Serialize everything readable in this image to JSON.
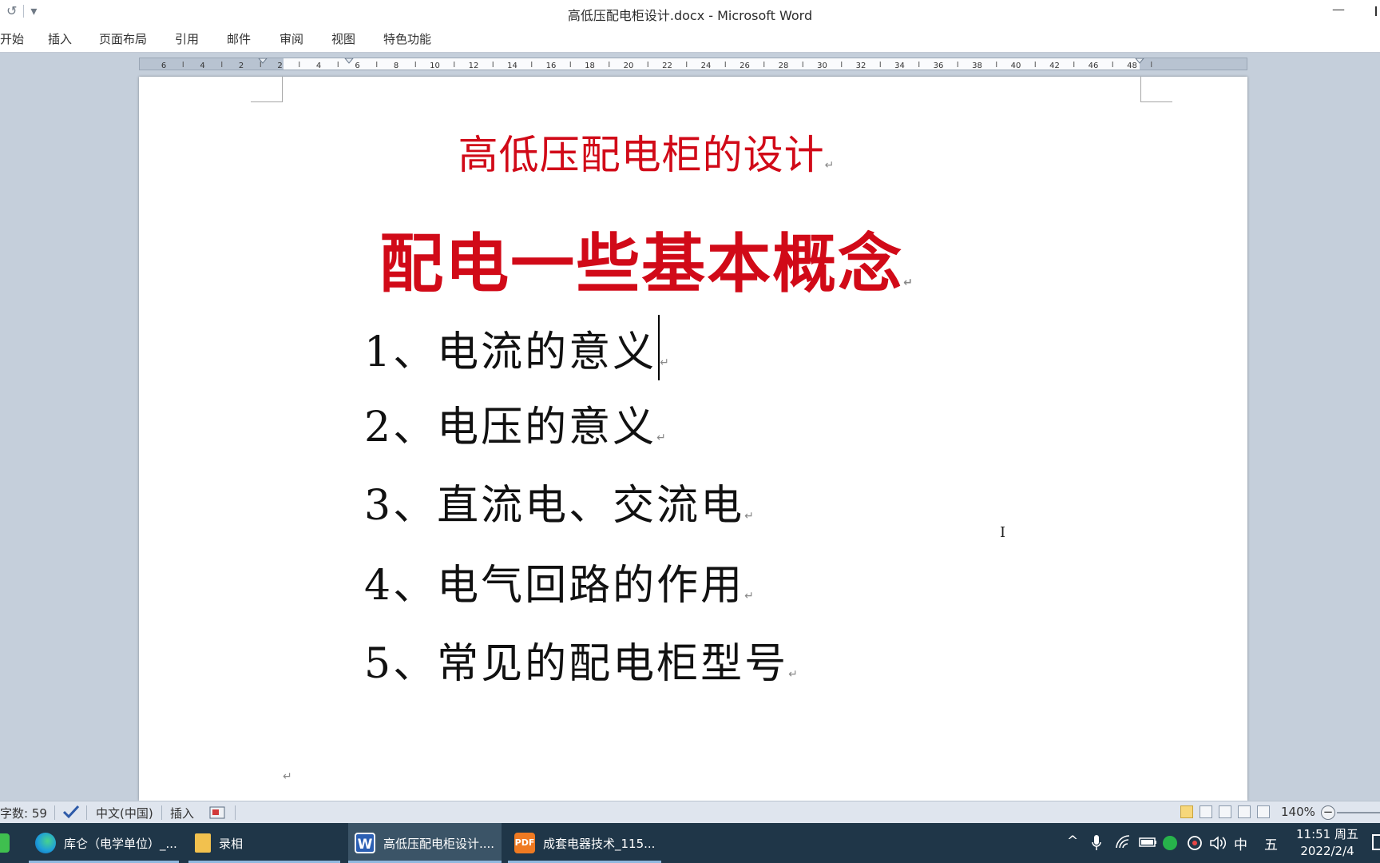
{
  "window": {
    "title": "高低压配电柜设计.docx - Microsoft Word",
    "minimize_glyph": "—"
  },
  "qat": {
    "undo_icon": "↺",
    "dropdown_icon": "▾"
  },
  "ribbon": {
    "tabs": [
      "开始",
      "插入",
      "页面布局",
      "引用",
      "邮件",
      "审阅",
      "视图",
      "特色功能"
    ]
  },
  "ruler": {
    "labels": [
      "6",
      "4",
      "2",
      "2",
      "4",
      "6",
      "8",
      "10",
      "12",
      "14",
      "16",
      "18",
      "20",
      "22",
      "24",
      "26",
      "28",
      "30",
      "32",
      "34",
      "36",
      "38",
      "40",
      "42",
      "46",
      "48"
    ]
  },
  "document": {
    "title": "高低压配电柜的设计",
    "subtitle": "配电一些基本概念",
    "items": [
      "1、电流的意义",
      "2、电压的意义",
      "3、直流电、交流电",
      "4、电气回路的作用",
      "5、常见的配电柜型号"
    ],
    "paragraph_mark": "↵",
    "ibeam_glyph": "I"
  },
  "statusbar": {
    "word_count": "字数: 59",
    "language": "中文(中国)",
    "mode": "插入",
    "zoom": "140%",
    "zoom_minus": "−"
  },
  "taskbar": {
    "apps": [
      {
        "label": "库仑（电学单位）_...",
        "icon": "edge-icon"
      },
      {
        "label": "录相",
        "icon": "folder-icon"
      },
      {
        "label": "高低压配电柜设计....",
        "icon": "word-icon"
      },
      {
        "label": "成套电器技术_115...",
        "icon": "pdf-icon"
      }
    ],
    "word_icon_letter": "W",
    "pdf_icon_letter": "PDF",
    "tray": {
      "chevron": "^",
      "ime_lang": "中",
      "ime_mode": "五"
    },
    "clock": {
      "time": "11:51 周五",
      "date": "2022/2/4"
    }
  },
  "colors": {
    "title_red": "#d10a18",
    "taskbar": "#1f3648",
    "app_background": "#c5cfdb"
  }
}
